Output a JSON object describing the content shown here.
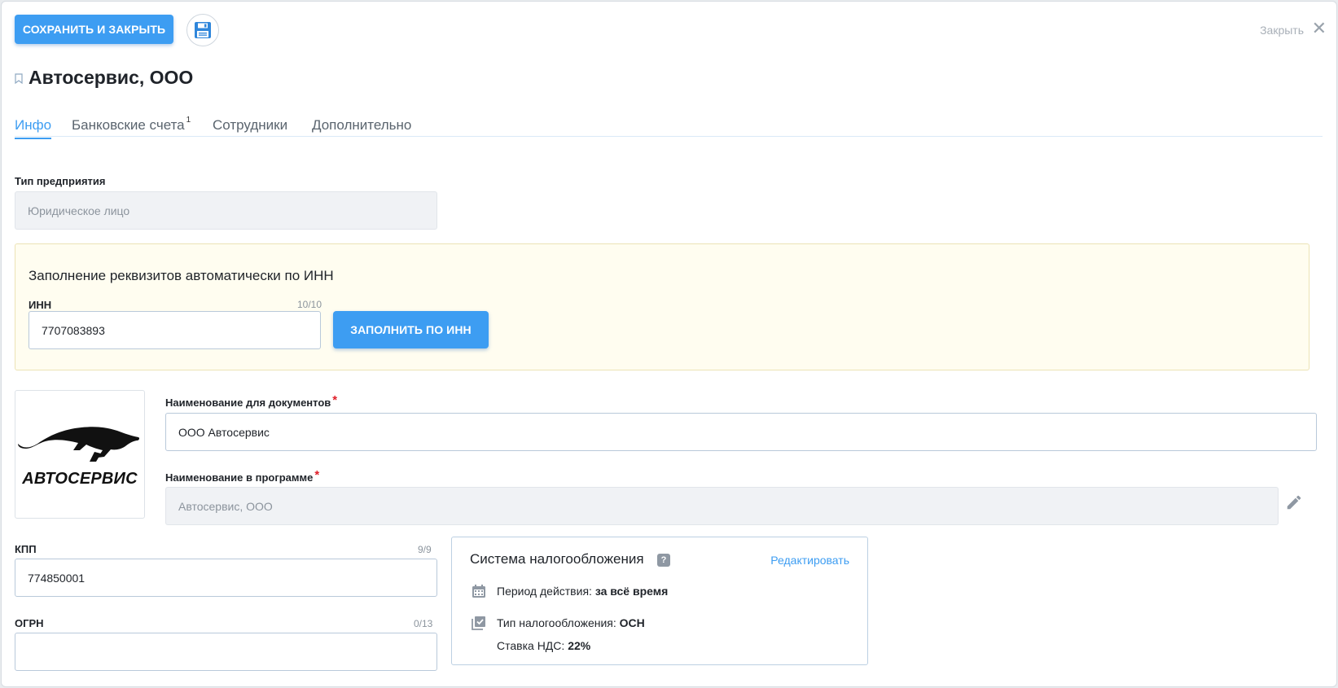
{
  "toolbar": {
    "save_close_label": "СОХРАНИТЬ И ЗАКРЫТЬ",
    "close_label": "Закрыть",
    "close_glyph": "✕"
  },
  "page": {
    "title": "Автосервис, ООО"
  },
  "tabs": [
    {
      "label": "Инфо",
      "badge": ""
    },
    {
      "label": "Банковские счета",
      "badge": "1"
    },
    {
      "label": "Сотрудники",
      "badge": ""
    },
    {
      "label": "Дополнительно",
      "badge": ""
    }
  ],
  "enterprise_type": {
    "label": "Тип предприятия",
    "value": "Юридическое лицо"
  },
  "inn_autofill": {
    "title": "Заполнение реквизитов автоматически по ИНН",
    "inn_label": "ИНН",
    "inn_counter": "10/10",
    "inn_value": "7707083893",
    "button_label": "ЗАПОЛНИТЬ ПО ИНН"
  },
  "logo": {
    "text": "АВТОСЕРВИС"
  },
  "doc_name": {
    "label": "Наименование для документов",
    "required_mark": "*",
    "value": "ООО Автосервис"
  },
  "program_name": {
    "label": "Наименование в программе",
    "required_mark": "*",
    "value": "Автосервис, ООО"
  },
  "kpp": {
    "label": "КПП",
    "counter": "9/9",
    "value": "774850001"
  },
  "ogrn": {
    "label": "ОГРН",
    "counter": "0/13",
    "value": ""
  },
  "tax_system": {
    "title": "Система налогообложения",
    "help_glyph": "?",
    "edit_label": "Редактировать",
    "period_label": "Период действия:",
    "period_value": "за всё время",
    "type_label": "Тип налогообложения:",
    "type_value": "ОСН",
    "vat_label": "Ставка НДС:",
    "vat_value": "22%"
  },
  "colors": {
    "accent": "#3d9df2",
    "highlight_bg": "#fffdf0",
    "required": "#e0202a"
  }
}
